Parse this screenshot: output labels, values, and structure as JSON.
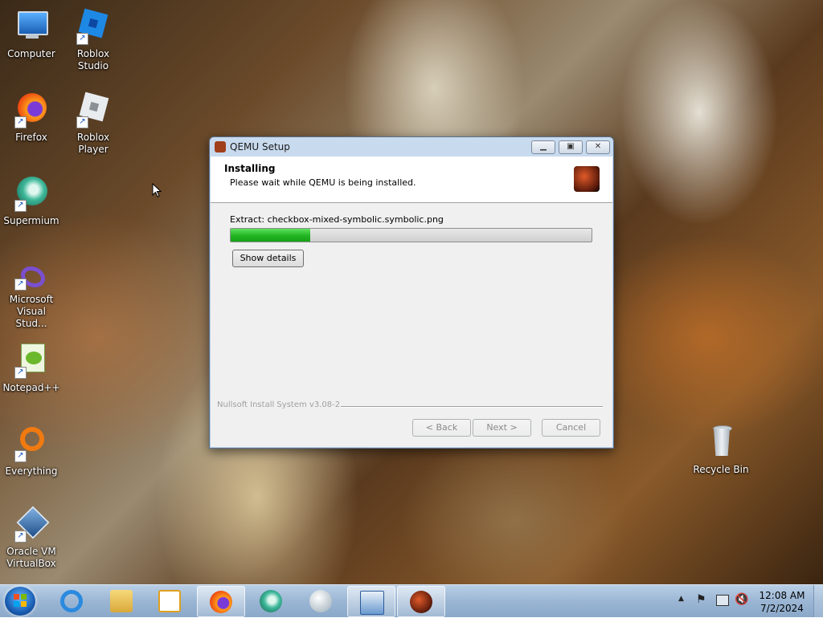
{
  "desktop": {
    "icons": [
      {
        "label": "Computer"
      },
      {
        "label": "Roblox Studio"
      },
      {
        "label": "Firefox"
      },
      {
        "label": "Roblox Player"
      },
      {
        "label": "Supermium"
      },
      {
        "label": "Microsoft Visual Stud..."
      },
      {
        "label": "Notepad++"
      },
      {
        "label": "Everything"
      },
      {
        "label": "Oracle VM VirtualBox"
      },
      {
        "label": "Recycle Bin"
      }
    ]
  },
  "window": {
    "title": "QEMU Setup",
    "header_title": "Installing",
    "header_subtitle": "Please wait while QEMU is being installed.",
    "extract_text": "Extract: checkbox-mixed-symbolic.symbolic.png",
    "progress_fraction": 0.22,
    "show_details_label": "Show details",
    "branding": "Nullsoft Install System v3.08-2",
    "back_label": "< Back",
    "next_label": "Next >",
    "cancel_label": "Cancel"
  },
  "taskbar": {
    "time": "12:08 AM",
    "date": "7/2/2024"
  },
  "colors": {
    "progress_green": "#22b422",
    "accent": "#1a5fb4"
  }
}
